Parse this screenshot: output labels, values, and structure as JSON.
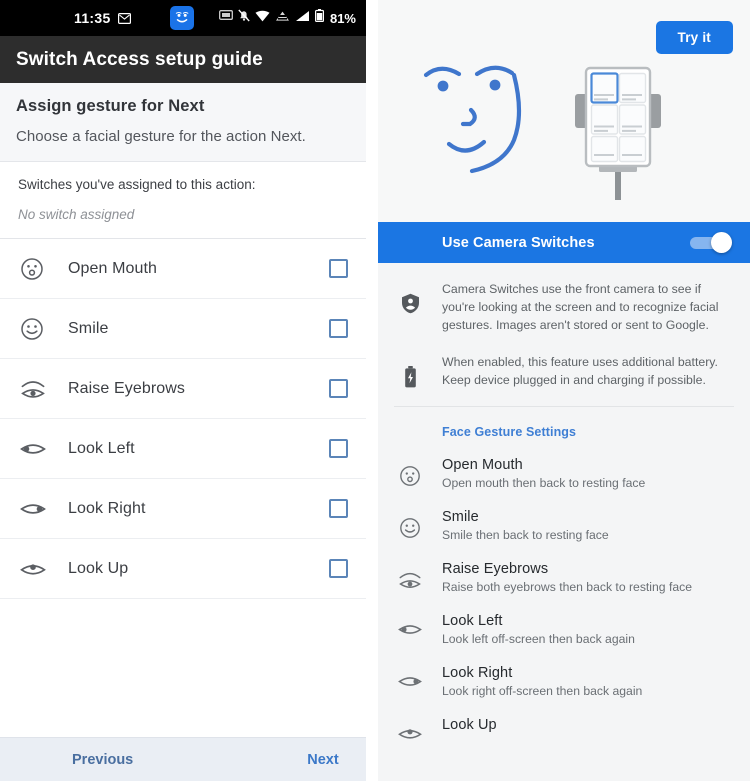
{
  "left": {
    "statusbar": {
      "time": "11:35",
      "battery_percent": "81%",
      "icons": [
        "message-icon",
        "face-badge-icon",
        "screenshot-icon",
        "bell-off-icon",
        "wifi-icon",
        "vpn-icon",
        "signal-icon",
        "battery-icon"
      ]
    },
    "titlebar": {
      "title": "Switch Access setup guide"
    },
    "assign": {
      "heading": "Assign gesture for Next",
      "subheading": "Choose a facial gesture for the action Next."
    },
    "assigned": {
      "label": "Switches you've assigned to this action:",
      "value": "No switch assigned"
    },
    "gestures": [
      {
        "icon": "open-mouth-face-icon",
        "label": "Open Mouth",
        "checked": false
      },
      {
        "icon": "smile-face-icon",
        "label": "Smile",
        "checked": false
      },
      {
        "icon": "raise-eyebrows-icon",
        "label": "Raise Eyebrows",
        "checked": false
      },
      {
        "icon": "look-left-eye-icon",
        "label": "Look Left",
        "checked": false
      },
      {
        "icon": "look-right-eye-icon",
        "label": "Look Right",
        "checked": false
      },
      {
        "icon": "look-up-eye-icon",
        "label": "Look Up",
        "checked": false
      }
    ],
    "nav": {
      "previous": "Previous",
      "next": "Next"
    }
  },
  "right": {
    "hero": {
      "try_button": "Try it",
      "illustration": "face-and-device-illustration"
    },
    "toggle": {
      "label": "Use Camera Switches",
      "state": "on"
    },
    "info": [
      {
        "icon": "privacy-shield-icon",
        "text": "Camera Switches use the front camera to see if you're looking at the screen and to recognize facial gestures. Images aren't stored or sent to Google."
      },
      {
        "icon": "battery-charging-icon",
        "text": "When enabled, this feature uses additional battery. Keep device plugged in and charging if possible."
      }
    ],
    "face_gesture_settings": {
      "header": "Face Gesture Settings",
      "items": [
        {
          "icon": "open-mouth-face-icon",
          "title": "Open Mouth",
          "desc": "Open mouth then back to resting face"
        },
        {
          "icon": "smile-face-icon",
          "title": "Smile",
          "desc": "Smile then back to resting face"
        },
        {
          "icon": "raise-eyebrows-icon",
          "title": "Raise Eyebrows",
          "desc": "Raise both eyebrows then back to resting face"
        },
        {
          "icon": "look-left-eye-icon",
          "title": "Look Left",
          "desc": "Look left off-screen then back again"
        },
        {
          "icon": "look-right-eye-icon",
          "title": "Look Right",
          "desc": "Look right off-screen then back again"
        },
        {
          "icon": "look-up-eye-icon",
          "title": "Look Up",
          "desc": ""
        }
      ]
    }
  },
  "colors": {
    "accent_blue": "#1b76e3",
    "link_blue": "#3f7fd4",
    "nav_blue": "#3b78c8",
    "statusbar_black": "#000000",
    "titlebar_dark": "#2d2d2d",
    "checkbox_border": "#5b85b8",
    "panel_bg": "#f4f5f6"
  }
}
